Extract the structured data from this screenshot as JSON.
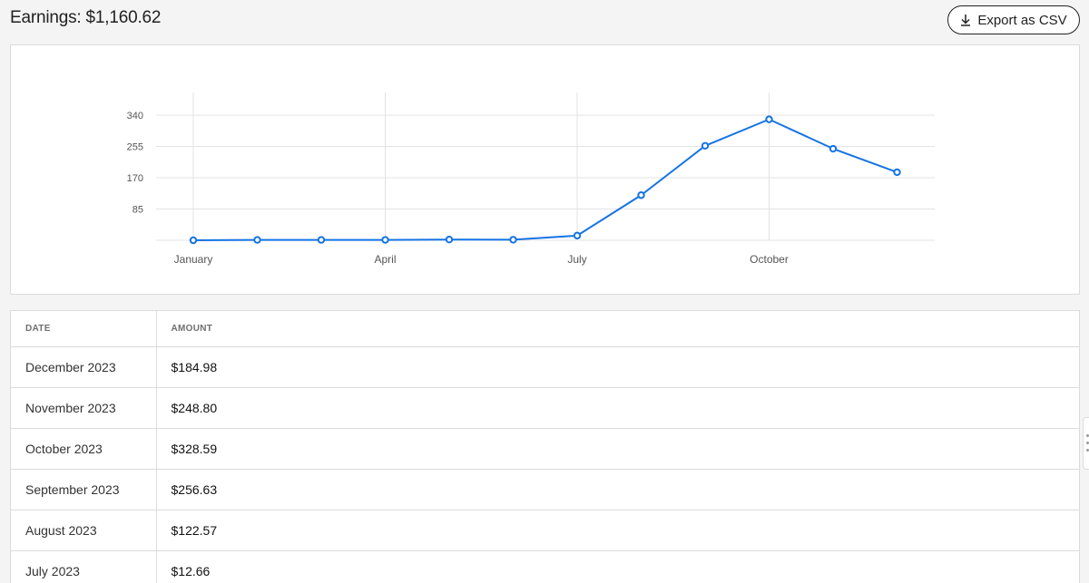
{
  "header": {
    "earnings_label": "Earnings: $1,160.62",
    "export_label": "Export as CSV",
    "export_icon": "download-icon"
  },
  "chart_data": {
    "type": "line",
    "x": [
      "January",
      "February",
      "March",
      "April",
      "May",
      "June",
      "July",
      "August",
      "September",
      "October",
      "November",
      "December"
    ],
    "x_tick_labels": [
      "January",
      "April",
      "July",
      "October"
    ],
    "series": [
      {
        "values": [
          0,
          1,
          1,
          1,
          2,
          1.5,
          12.66,
          122.57,
          256.63,
          328.59,
          248.8,
          184.98
        ]
      }
    ],
    "y_ticks": [
      85,
      170,
      255,
      340
    ],
    "ylim": [
      0,
      340
    ],
    "grid": true,
    "line_color": "#1473e6"
  },
  "table": {
    "columns": [
      "DATE",
      "AMOUNT"
    ],
    "rows": [
      {
        "date": "December 2023",
        "amount": "$184.98"
      },
      {
        "date": "November 2023",
        "amount": "$248.80"
      },
      {
        "date": "October 2023",
        "amount": "$328.59"
      },
      {
        "date": "September 2023",
        "amount": "$256.63"
      },
      {
        "date": "August 2023",
        "amount": "$122.57"
      },
      {
        "date": "July 2023",
        "amount": "$12.66"
      }
    ]
  }
}
